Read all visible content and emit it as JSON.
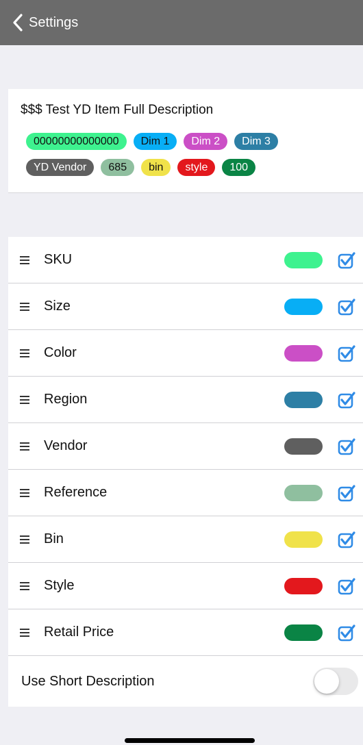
{
  "nav": {
    "back_label": "Settings"
  },
  "preview": {
    "title": "$$$ Test YD Item Full Description",
    "tags_row1": [
      {
        "text": "00000000000000",
        "color": "#3ef28f",
        "text_color": "#111111"
      },
      {
        "text": "Dim 1",
        "color": "#08aef5",
        "text_color": "#111111"
      },
      {
        "text": "Dim 2",
        "color": "#cb4fc6",
        "text_color": "#ffffff"
      },
      {
        "text": "Dim 3",
        "color": "#2d7fa5",
        "text_color": "#ffffff"
      }
    ],
    "tags_row2": [
      {
        "text": "YD Vendor",
        "color": "#5f5f5f",
        "text_color": "#ffffff"
      },
      {
        "text": "685",
        "color": "#8fbf9f",
        "text_color": "#111111"
      },
      {
        "text": "bin",
        "color": "#f0e24a",
        "text_color": "#111111"
      },
      {
        "text": "style",
        "color": "#e3181d",
        "text_color": "#ffffff"
      },
      {
        "text": "100",
        "color": "#0a8445",
        "text_color": "#ffffff"
      }
    ]
  },
  "fields": [
    {
      "label": "SKU",
      "color": "#3ef28f",
      "checked": true
    },
    {
      "label": "Size",
      "color": "#08aef5",
      "checked": true
    },
    {
      "label": "Color",
      "color": "#cb4fc6",
      "checked": true
    },
    {
      "label": "Region",
      "color": "#2d7fa5",
      "checked": true
    },
    {
      "label": "Vendor",
      "color": "#5f5f5f",
      "checked": true
    },
    {
      "label": "Reference",
      "color": "#8fbf9f",
      "checked": true
    },
    {
      "label": "Bin",
      "color": "#f0e24a",
      "checked": true
    },
    {
      "label": "Style",
      "color": "#e3181d",
      "checked": true
    },
    {
      "label": "Retail Price",
      "color": "#0a8445",
      "checked": true
    }
  ],
  "short_description": {
    "label": "Use Short Description",
    "enabled": false
  },
  "icons": {
    "back": "chevron-left-icon",
    "drag": "drag-handle-icon",
    "check": "checkbox-checked-icon"
  },
  "accent_color": "#2f8be6"
}
